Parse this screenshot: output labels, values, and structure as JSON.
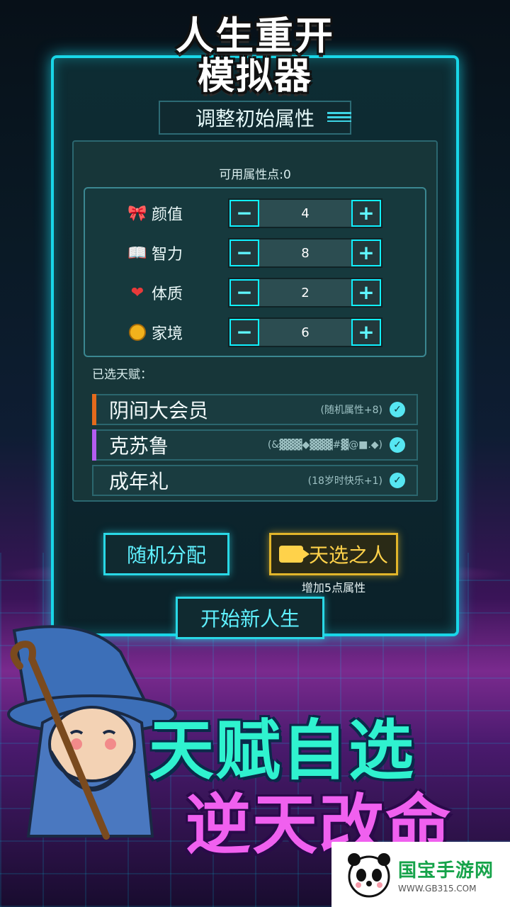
{
  "title": {
    "line1": "人生重开",
    "line2": "模拟器"
  },
  "header": {
    "label": "调整初始属性"
  },
  "points_label": "可用属性点:0",
  "attributes": [
    {
      "icon": "bow-icon",
      "label": "颜值",
      "value": "4"
    },
    {
      "icon": "book-icon",
      "label": "智力",
      "value": "8"
    },
    {
      "icon": "heart-icon",
      "label": "体质",
      "value": "2"
    },
    {
      "icon": "coin-icon",
      "label": "家境",
      "value": "6"
    }
  ],
  "stepper": {
    "minus": "−",
    "plus": "+"
  },
  "selected_label": "已选天赋：",
  "talents": [
    {
      "name": "阴间大会员",
      "desc": "(随机属性+8)",
      "color": "#e46a1c"
    },
    {
      "name": "克苏鲁",
      "desc": "(&▓▓▓◆▓▓▓#▓@■.◆)",
      "color": "#b45cf0"
    },
    {
      "name": "成年礼",
      "desc": "(18岁时快乐+1)",
      "color": ""
    }
  ],
  "check_mark": "✓",
  "buttons": {
    "random": "随机分配",
    "chosen": "天选之人",
    "chosen_sub": "增加5点属性",
    "start": "开始新人生"
  },
  "slogan": {
    "line1": "天赋自选",
    "line2": "逆天改命"
  },
  "watermark": {
    "name": "国宝手游网",
    "url": "WWW.GB315.COM"
  },
  "colors": {
    "accent": "#19d6e8",
    "gold": "#e2b52a",
    "slogan1": "#2ff2cf",
    "slogan2": "#f060ef"
  }
}
